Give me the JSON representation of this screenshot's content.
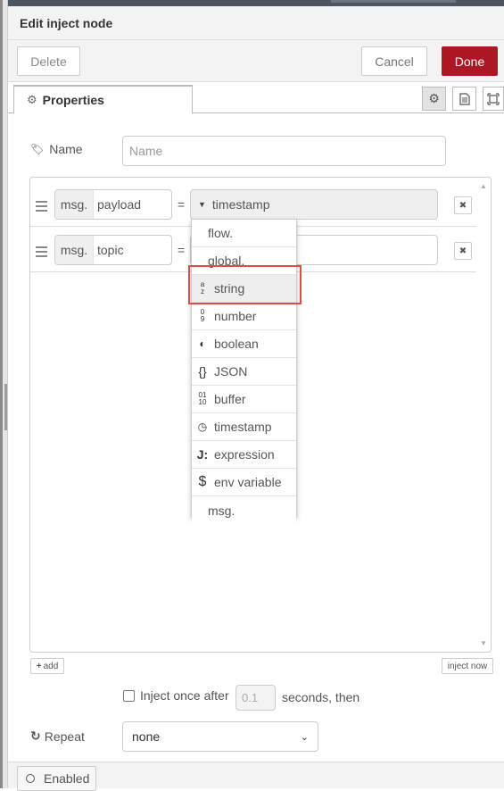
{
  "header": {
    "title": "Edit inject node"
  },
  "buttons": {
    "delete": "Delete",
    "cancel": "Cancel",
    "done": "Done"
  },
  "colors": {
    "done_bg": "#ad1625",
    "highlight": "#e04a4a"
  },
  "tabs": {
    "properties": "Properties",
    "icons": [
      "gear-icon",
      "file-text-icon",
      "frame-icon"
    ]
  },
  "name": {
    "label": "Name",
    "placeholder": "Name"
  },
  "properties": [
    {
      "prefix": "msg.",
      "key": "payload",
      "type": "timestamp"
    },
    {
      "prefix": "msg.",
      "key": "topic",
      "type": ""
    }
  ],
  "type_menu": {
    "items": [
      {
        "label": "flow.",
        "icon": ""
      },
      {
        "label": "global.",
        "icon": ""
      },
      {
        "label": "string",
        "icon": "az-icon",
        "highlighted": true
      },
      {
        "label": "number",
        "icon": "09-icon"
      },
      {
        "label": "boolean",
        "icon": "boolean-icon"
      },
      {
        "label": "JSON",
        "icon": "braces-icon"
      },
      {
        "label": "buffer",
        "icon": "binary-icon"
      },
      {
        "label": "timestamp",
        "icon": "clock-icon"
      },
      {
        "label": "expression",
        "icon": "jsonata-icon"
      },
      {
        "label": "env variable",
        "icon": "dollar-icon"
      },
      {
        "label": "msg.",
        "icon": ""
      }
    ]
  },
  "list_actions": {
    "add": "add",
    "inject_now": "inject now"
  },
  "inject_once": {
    "label": "Inject once after",
    "delay": "0.1",
    "suffix": "seconds, then"
  },
  "repeat": {
    "label": "Repeat",
    "value": "none"
  },
  "footer": {
    "enabled": "Enabled"
  }
}
